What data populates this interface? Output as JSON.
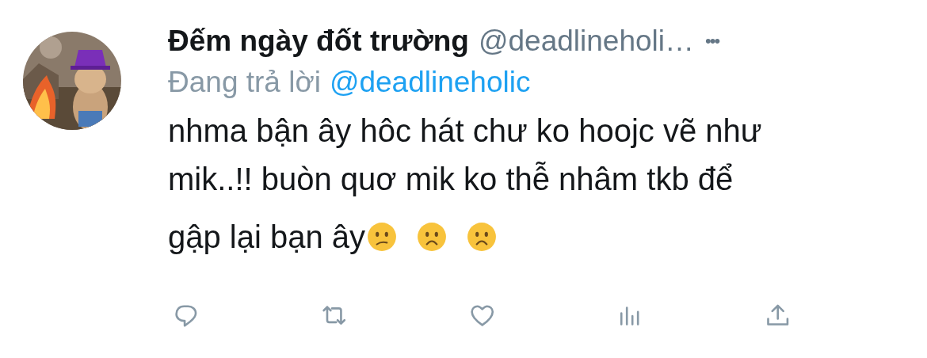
{
  "tweet": {
    "author_name": "Đếm ngày đốt trường",
    "handle": "@deadlineholi…",
    "more": "•••",
    "reply_prefix": "Đang trả lời",
    "reply_to": "@deadlineholic",
    "text_lines": [
      "nhma bận ây hôc hát chư ko hoojc vẽ như",
      "mik..!! buòn quơ mik ko thễ nhâm tkb để",
      "gập lại bạn ây"
    ],
    "emojis": [
      {
        "kind": "confused"
      },
      {
        "kind": "frowning"
      },
      {
        "kind": "frowning"
      }
    ],
    "actions": [
      {
        "kind": "reply"
      },
      {
        "kind": "retweet"
      },
      {
        "kind": "like"
      },
      {
        "kind": "analytics"
      },
      {
        "kind": "share"
      }
    ]
  }
}
